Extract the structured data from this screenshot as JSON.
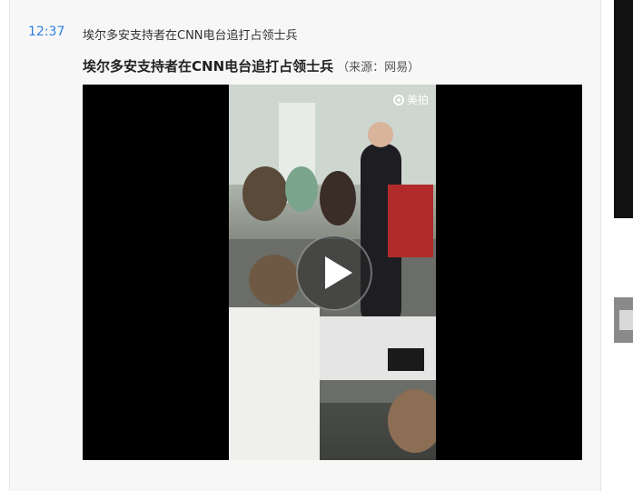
{
  "feed": {
    "time": "12:37",
    "headline": "埃尔多安支持者在CNN电台追打占领士兵",
    "story_title": "埃尔多安支持者在CNN电台追打占领士兵",
    "story_source": "（来源：网易）",
    "video": {
      "watermark": "美拍",
      "play_icon": "play-icon"
    }
  },
  "colors": {
    "time": "#2f7fe0",
    "panel_bg": "#f7f7f7",
    "video_bg": "#000000"
  }
}
